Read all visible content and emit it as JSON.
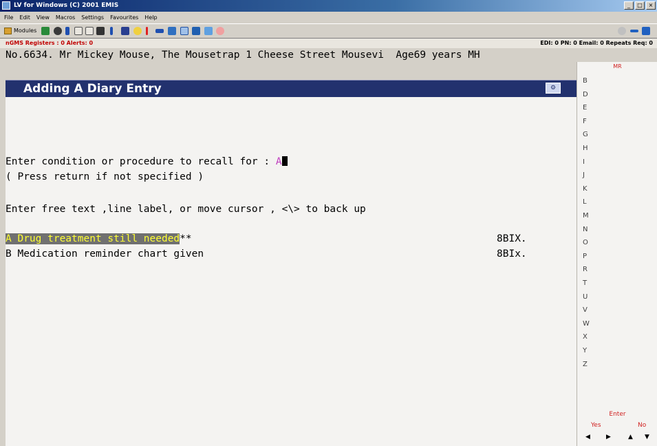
{
  "window": {
    "title": "LV for Windows (C) 2001 EMIS"
  },
  "menu": [
    "File",
    "Edit",
    "View",
    "Macros",
    "Settings",
    "Favourites",
    "Help"
  ],
  "toolbar": {
    "modules_label": "Modules"
  },
  "status_strip": {
    "left": "nGMS Registers : 0  Alerts: 0",
    "right": "EDI: 0  PN: 0  Email: 0  Repeats Req: 0"
  },
  "patient": {
    "line": "No.6634. Mr Mickey Mouse, The Mousetrap 1 Cheese Street Mousevi  Age69 years MH"
  },
  "header": {
    "title": "Adding A Diary Entry"
  },
  "prompt": {
    "label": "Enter condition or procedure to recall for : ",
    "value": "A",
    "hint": "( Press return if not specified )",
    "instructions": "Enter free text ,line label, or move cursor , <\\> to back up"
  },
  "options": [
    {
      "text": "A Drug treatment still needed",
      "suffix": "**",
      "code": "8BIX."
    },
    {
      "text": "B Medication reminder chart given",
      "suffix": "",
      "code": "8BIx."
    }
  ],
  "sidebar": {
    "header": "MR",
    "letters": [
      "B",
      "D",
      "E",
      "F",
      "G",
      "H",
      "I",
      "J",
      "K",
      "L",
      "M",
      "N",
      "O",
      "P",
      "R",
      "T",
      "U",
      "V",
      "W",
      "X",
      "Y",
      "Z"
    ],
    "enter_label": "Enter",
    "yes_label": "Yes",
    "no_label": "No"
  }
}
